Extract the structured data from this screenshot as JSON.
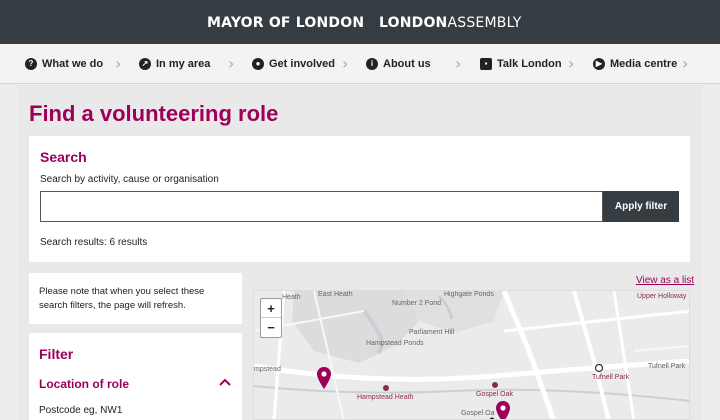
{
  "header": {
    "brand_mayor": "MAYOR OF LONDON",
    "brand_assembly_bold": "LONDON",
    "brand_assembly_thin": "ASSEMBLY"
  },
  "nav": {
    "items": [
      {
        "label": "What we do",
        "icon": "question-icon"
      },
      {
        "label": "In my area",
        "icon": "compass-icon"
      },
      {
        "label": "Get involved",
        "icon": "pin-icon"
      },
      {
        "label": "About us",
        "icon": "info-icon"
      },
      {
        "label": "Talk London",
        "icon": "speech-bubble-icon"
      },
      {
        "label": "Media centre",
        "icon": "play-icon"
      }
    ]
  },
  "page": {
    "title": "Find a volunteering role"
  },
  "search": {
    "heading": "Search",
    "label": "Search by activity, cause or organisation",
    "value": "",
    "apply_label": "Apply filter",
    "results_text": "Search results: 6 results"
  },
  "note": {
    "text": "Please note that when you select these search filters, the page will refresh."
  },
  "filter": {
    "heading": "Filter",
    "location_label": "Location of role",
    "postcode_label": "Postcode eg, NW1"
  },
  "view_list": "View as a list",
  "map": {
    "zoom_in": "+",
    "zoom_out": "−",
    "labels": {
      "east_heath": "East Heath",
      "highgate_ponds": "Highgate Ponds",
      "number2_pond": "Number 2 Pond",
      "parliament_hill": "Parliament Hill",
      "hampstead_ponds": "Hampstead Ponds",
      "hampstead": "mpstead",
      "hampstead_heath": "Hampstead Heath",
      "gospel_oak": "Gospel Oak",
      "gospel_oak2": "Gospel Oa",
      "tufnell_park": "Tufnell Park",
      "tufnell_park2": "Tufnell Park",
      "upper_holloway": "Upper Holloway",
      "heath": "Heath"
    },
    "colors": {
      "pin": "#9e0059",
      "station": "#8b2b4c"
    }
  }
}
